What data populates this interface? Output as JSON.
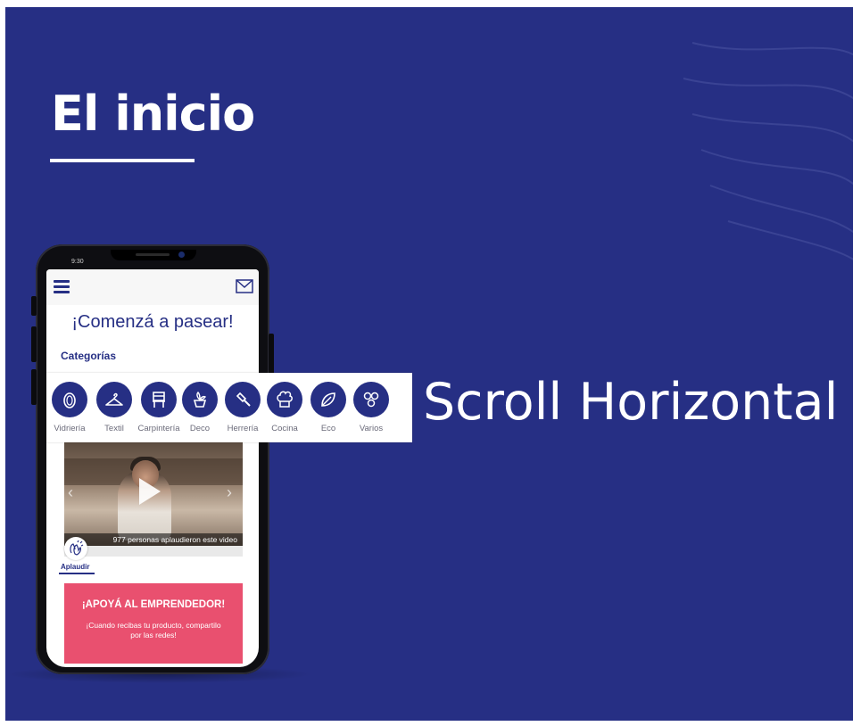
{
  "slide": {
    "title": "El inicio",
    "scroll_label": "Scroll Horizontal"
  },
  "phone": {
    "status_time": "9:30",
    "screen": {
      "greeting": "¡Comenzá a pasear!",
      "categories_title": "Categorías",
      "categories": [
        {
          "label": "Vidriería",
          "icon": "vase-icon"
        },
        {
          "label": "Textil",
          "icon": "hanger-icon"
        },
        {
          "label": "Carpintería",
          "icon": "chair-icon"
        },
        {
          "label": "Deco",
          "icon": "plant-pot-icon"
        },
        {
          "label": "Herrería",
          "icon": "hammer-icon"
        },
        {
          "label": "Cocina",
          "icon": "chef-hat-icon"
        },
        {
          "label": "Eco",
          "icon": "leaf-icon"
        },
        {
          "label": "Varios",
          "icon": "circles-icon"
        }
      ],
      "video_caption": "977 personas aplaudieron este video",
      "applaud_label": "Aplaudir",
      "promo": {
        "title": "¡APOYÁ AL EMPRENDEDOR!",
        "text": "¡Cuando recibas tu producto, compartilo por las redes!"
      }
    }
  },
  "colors": {
    "background": "#262f84",
    "accent": "#262f84",
    "promo": "#e9506f",
    "text_light": "#ffffff"
  }
}
